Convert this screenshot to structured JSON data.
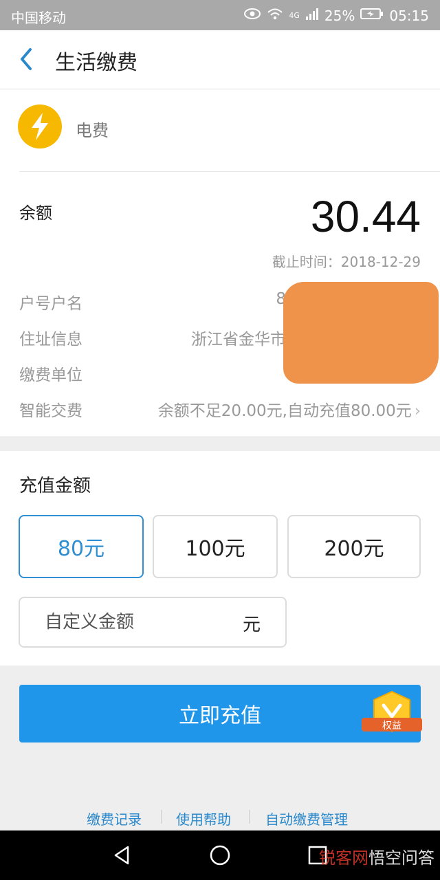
{
  "status_bar": {
    "carrier": "中国移动",
    "network": "4G",
    "battery": "25%",
    "time": "05:15"
  },
  "header": {
    "title": "生活缴费"
  },
  "bill": {
    "type_label": "电费",
    "balance_label": "余额",
    "balance_value": "30.44",
    "deadline_label": "截止时间：2018-12-29"
  },
  "details": [
    {
      "label": "户号户名",
      "value": "8"
    },
    {
      "label": "住址信息",
      "value": "浙江省金华市"
    },
    {
      "label": "缴费单位",
      "value": ""
    },
    {
      "label": "智能交费",
      "value": "余额不足20.00元,自动充值80.00元"
    }
  ],
  "recharge": {
    "title": "充值金额",
    "options": [
      "80元",
      "100元",
      "200元"
    ],
    "selected_index": 0,
    "custom_placeholder": "自定义金额",
    "custom_unit": "元",
    "submit_label": "立即充值",
    "badge_label": "权益"
  },
  "links": [
    "缴费记录",
    "使用帮助",
    "自动缴费管理"
  ],
  "watermark": {
    "part1": "锐客网",
    "part2": "悟空问答"
  },
  "colors": {
    "accent": "#1f96ea",
    "icon_yellow": "#f6b800",
    "link": "#2a88cc"
  }
}
